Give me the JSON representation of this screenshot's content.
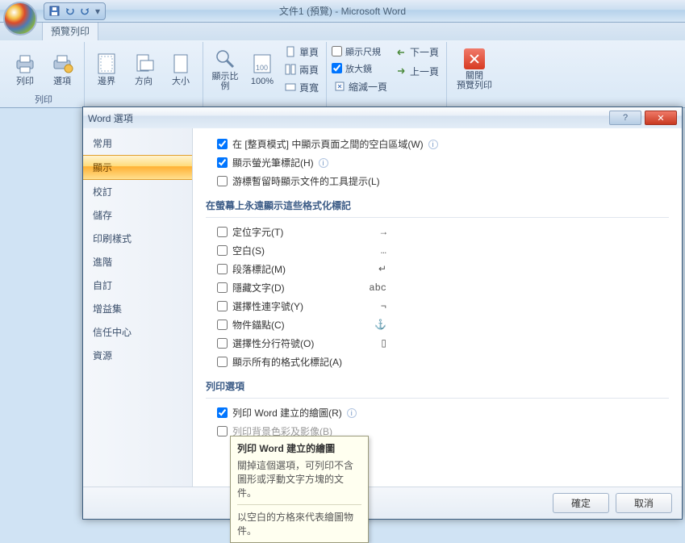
{
  "titlebar": {
    "title": "文件1 (預覽) - Microsoft Word"
  },
  "ribbon_tab": "預覽列印",
  "ribbon": {
    "group1": {
      "title": "列印",
      "print": "列印",
      "options": "選項"
    },
    "group2": {
      "margins": "邊界",
      "orient": "方向",
      "size": "大小"
    },
    "group3": {
      "zoom": "顯示比例",
      "p100": "100%",
      "one": "單頁",
      "two": "兩頁",
      "width": "頁寬"
    },
    "group4": {
      "ruler": "顯示尺規",
      "magnify": "放大鏡",
      "shrink": "縮減一頁",
      "next": "下一頁",
      "prev": "上一頁"
    },
    "group5": {
      "close1": "關閉",
      "close2": "預覽列印"
    }
  },
  "dialog": {
    "title": "Word 選項",
    "sidebar": [
      "常用",
      "顯示",
      "校訂",
      "儲存",
      "印刷樣式",
      "進階",
      "自訂",
      "增益集",
      "信任中心",
      "資源"
    ],
    "selected_index": 1,
    "top_opts": [
      "在 [整頁模式] 中顯示頁面之間的空白區域(W)",
      "顯示螢光筆標記(H)",
      "游標暫留時顯示文件的工具提示(L)"
    ],
    "section1": "在螢幕上永遠顯示這些格式化標記",
    "fmt_opts": [
      {
        "label": "定位字元(T)",
        "sym": "→"
      },
      {
        "label": "空白(S)",
        "sym": "…"
      },
      {
        "label": "段落標記(M)",
        "sym": "↵"
      },
      {
        "label": "隱藏文字(D)",
        "sym": "abc"
      },
      {
        "label": "選擇性連字號(Y)",
        "sym": "¬"
      },
      {
        "label": "物件錨點(C)",
        "sym": "⚓"
      },
      {
        "label": "選擇性分行符號(O)",
        "sym": "▯"
      },
      {
        "label": "顯示所有的格式化標記(A)",
        "sym": ""
      }
    ],
    "section2": "列印選項",
    "print_opts": [
      {
        "label": "列印 Word 建立的繪圖(R)",
        "checked": true,
        "info": true
      },
      {
        "label": "列印背景色彩及影像(B)",
        "checked": false,
        "grey": true
      }
    ],
    "ok": "確定",
    "cancel": "取消"
  },
  "tooltip": {
    "title": "列印 Word 建立的繪圖",
    "body": "關掉這個選項，可列印不含圖形或浮動文字方塊的文件。",
    "sub": "以空白的方格來代表繪圖物件。"
  }
}
